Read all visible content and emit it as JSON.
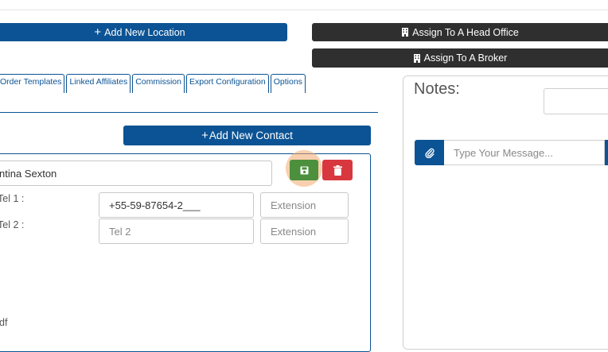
{
  "buttons": {
    "add_location": "Add New Location",
    "assign_head_office": "Assign To A Head Office",
    "assign_broker": "Assign To A Broker",
    "add_contact": "Add New Contact"
  },
  "tabs": [
    {
      "label": "Order Templates"
    },
    {
      "label": "Linked Affiliates"
    },
    {
      "label": "Commission"
    },
    {
      "label": "Export Configuration"
    },
    {
      "label": "Options"
    }
  ],
  "contact": {
    "name_value": "ntina Sexton",
    "tel1_label": "Tel 1 :",
    "tel1_value": "+55-59-87654-2___",
    "tel1_ext_placeholder": "Extension",
    "tel2_label": "Tel 2 :",
    "tel2_placeholder": "Tel 2",
    "tel2_ext_placeholder": "Extension",
    "bottom_text": "df"
  },
  "notes": {
    "title": "Notes:",
    "message_placeholder": "Type Your Message..."
  },
  "colors": {
    "primary": "#0b5394",
    "dark": "#2f2f2f",
    "save": "#4c8f3c",
    "delete": "#d9373f",
    "highlight": "#f4aa6e"
  },
  "icons": {
    "building": "building-icon",
    "save": "floppy-disk-icon",
    "delete": "trash-icon",
    "attach": "paperclip-icon"
  }
}
